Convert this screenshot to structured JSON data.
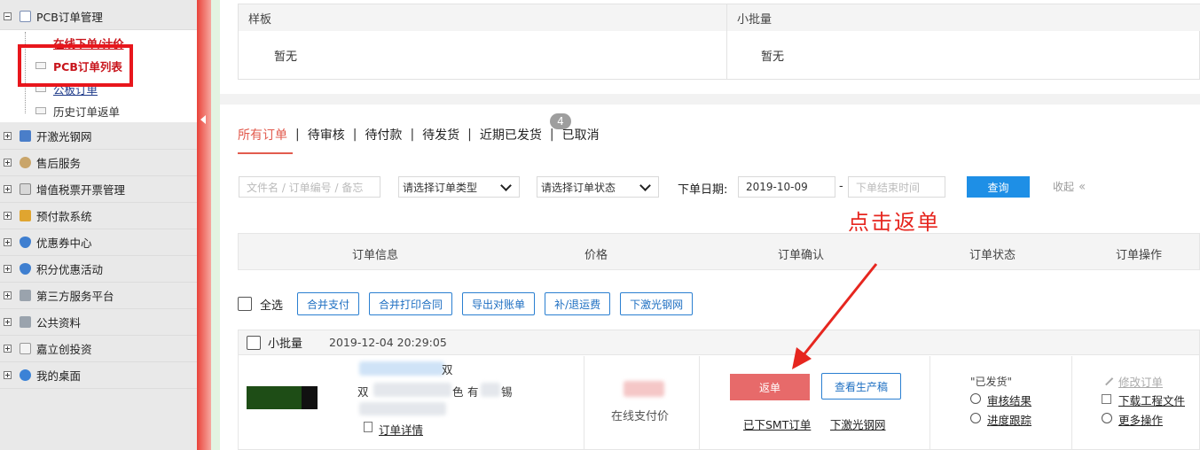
{
  "sidebar": {
    "items": [
      {
        "label": "PCB订单管理",
        "icon": "order-icon"
      },
      {
        "label": "开激光钢网",
        "icon": "laser-icon"
      },
      {
        "label": "售后服务",
        "icon": "person-icon"
      },
      {
        "label": "增值税票开票管理",
        "icon": "invoice-icon"
      },
      {
        "label": "预付款系统",
        "icon": "database-icon"
      },
      {
        "label": "优惠券中心",
        "icon": "shield-icon"
      },
      {
        "label": "积分优惠活动",
        "icon": "shield-icon"
      },
      {
        "label": "第三方服务平台",
        "icon": "grid-icon"
      },
      {
        "label": "公共资料",
        "icon": "grid-icon"
      },
      {
        "label": "嘉立创投资",
        "icon": "page-icon"
      },
      {
        "label": "我的桌面",
        "icon": "chat-icon"
      }
    ],
    "subitems": [
      {
        "label": "在线下单/计价"
      },
      {
        "label": "PCB订单列表"
      },
      {
        "label": "公板订单"
      },
      {
        "label": "历史订单返单"
      }
    ]
  },
  "sample_table": {
    "col1_title": "样板",
    "col1_value": "暂无",
    "col2_title": "小批量",
    "col2_value": "暂无"
  },
  "tabs": [
    {
      "label": "所有订单",
      "active": true
    },
    {
      "label": "待审核"
    },
    {
      "label": "待付款"
    },
    {
      "label": "待发货"
    },
    {
      "label": "近期已发货",
      "badge": "4"
    },
    {
      "label": "已取消"
    }
  ],
  "filters": {
    "search_placeholder": "文件名 / 订单编号 / 备忘",
    "order_type": "请选择订单类型",
    "order_status": "请选择订单状态",
    "date_label": "下单日期:",
    "date_from": "2019-10-09",
    "date_dash": "-",
    "date_to_placeholder": "下单结束时间",
    "query_button": "查询",
    "collapse": "收起"
  },
  "annotation": "点击返单",
  "table_headers": [
    "订单信息",
    "价格",
    "订单确认",
    "订单状态",
    "订单操作"
  ],
  "bulk_actions": {
    "select_all": "全选",
    "buttons": [
      "合并支付",
      "合并打印合同",
      "导出对账单",
      "补/退运费",
      "下激光钢网"
    ]
  },
  "order": {
    "type": "小批量",
    "time": "2019-12-04 20:29:05",
    "info_fragments": [
      "双",
      "色",
      "有",
      "锡",
      "双"
    ],
    "detail_link": "订单详情",
    "price_label": "在线支付价",
    "return_button": "返单",
    "draft_button": "查看生产稿",
    "smt_link": "已下SMT订单",
    "laser_link": "下激光钢网",
    "status": "\"已发货\"",
    "review_link": "审核结果",
    "progress_link": "进度跟踪",
    "modify_link": "修改订单",
    "download_link": "下载工程文件",
    "more_link": "更多操作"
  },
  "colors": {
    "accent_red": "#e25b4e",
    "highlight_red": "#e8161c",
    "primary_blue": "#1e8fe6"
  }
}
